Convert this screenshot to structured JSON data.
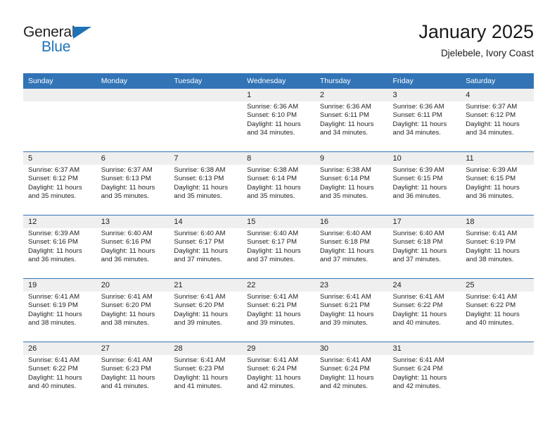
{
  "brand": {
    "name_top": "General",
    "name_bottom": "Blue",
    "triangle_color": "#1d72b8"
  },
  "header": {
    "title": "January 2025",
    "location": "Djelebele, Ivory Coast"
  },
  "theme": {
    "header_blue": "#3274b6",
    "daynum_band": "#efefef",
    "text": "#231f20"
  },
  "calendar": {
    "weekday_headers": [
      "Sunday",
      "Monday",
      "Tuesday",
      "Wednesday",
      "Thursday",
      "Friday",
      "Saturday"
    ],
    "weeks": [
      {
        "days": [
          {
            "num": "",
            "lines": []
          },
          {
            "num": "",
            "lines": []
          },
          {
            "num": "",
            "lines": []
          },
          {
            "num": "1",
            "lines": [
              "Sunrise: 6:36 AM",
              "Sunset: 6:10 PM",
              "Daylight: 11 hours",
              "and 34 minutes."
            ]
          },
          {
            "num": "2",
            "lines": [
              "Sunrise: 6:36 AM",
              "Sunset: 6:11 PM",
              "Daylight: 11 hours",
              "and 34 minutes."
            ]
          },
          {
            "num": "3",
            "lines": [
              "Sunrise: 6:36 AM",
              "Sunset: 6:11 PM",
              "Daylight: 11 hours",
              "and 34 minutes."
            ]
          },
          {
            "num": "4",
            "lines": [
              "Sunrise: 6:37 AM",
              "Sunset: 6:12 PM",
              "Daylight: 11 hours",
              "and 34 minutes."
            ]
          }
        ]
      },
      {
        "days": [
          {
            "num": "5",
            "lines": [
              "Sunrise: 6:37 AM",
              "Sunset: 6:12 PM",
              "Daylight: 11 hours",
              "and 35 minutes."
            ]
          },
          {
            "num": "6",
            "lines": [
              "Sunrise: 6:37 AM",
              "Sunset: 6:13 PM",
              "Daylight: 11 hours",
              "and 35 minutes."
            ]
          },
          {
            "num": "7",
            "lines": [
              "Sunrise: 6:38 AM",
              "Sunset: 6:13 PM",
              "Daylight: 11 hours",
              "and 35 minutes."
            ]
          },
          {
            "num": "8",
            "lines": [
              "Sunrise: 6:38 AM",
              "Sunset: 6:14 PM",
              "Daylight: 11 hours",
              "and 35 minutes."
            ]
          },
          {
            "num": "9",
            "lines": [
              "Sunrise: 6:38 AM",
              "Sunset: 6:14 PM",
              "Daylight: 11 hours",
              "and 35 minutes."
            ]
          },
          {
            "num": "10",
            "lines": [
              "Sunrise: 6:39 AM",
              "Sunset: 6:15 PM",
              "Daylight: 11 hours",
              "and 36 minutes."
            ]
          },
          {
            "num": "11",
            "lines": [
              "Sunrise: 6:39 AM",
              "Sunset: 6:15 PM",
              "Daylight: 11 hours",
              "and 36 minutes."
            ]
          }
        ]
      },
      {
        "days": [
          {
            "num": "12",
            "lines": [
              "Sunrise: 6:39 AM",
              "Sunset: 6:16 PM",
              "Daylight: 11 hours",
              "and 36 minutes."
            ]
          },
          {
            "num": "13",
            "lines": [
              "Sunrise: 6:40 AM",
              "Sunset: 6:16 PM",
              "Daylight: 11 hours",
              "and 36 minutes."
            ]
          },
          {
            "num": "14",
            "lines": [
              "Sunrise: 6:40 AM",
              "Sunset: 6:17 PM",
              "Daylight: 11 hours",
              "and 37 minutes."
            ]
          },
          {
            "num": "15",
            "lines": [
              "Sunrise: 6:40 AM",
              "Sunset: 6:17 PM",
              "Daylight: 11 hours",
              "and 37 minutes."
            ]
          },
          {
            "num": "16",
            "lines": [
              "Sunrise: 6:40 AM",
              "Sunset: 6:18 PM",
              "Daylight: 11 hours",
              "and 37 minutes."
            ]
          },
          {
            "num": "17",
            "lines": [
              "Sunrise: 6:40 AM",
              "Sunset: 6:18 PM",
              "Daylight: 11 hours",
              "and 37 minutes."
            ]
          },
          {
            "num": "18",
            "lines": [
              "Sunrise: 6:41 AM",
              "Sunset: 6:19 PM",
              "Daylight: 11 hours",
              "and 38 minutes."
            ]
          }
        ]
      },
      {
        "days": [
          {
            "num": "19",
            "lines": [
              "Sunrise: 6:41 AM",
              "Sunset: 6:19 PM",
              "Daylight: 11 hours",
              "and 38 minutes."
            ]
          },
          {
            "num": "20",
            "lines": [
              "Sunrise: 6:41 AM",
              "Sunset: 6:20 PM",
              "Daylight: 11 hours",
              "and 38 minutes."
            ]
          },
          {
            "num": "21",
            "lines": [
              "Sunrise: 6:41 AM",
              "Sunset: 6:20 PM",
              "Daylight: 11 hours",
              "and 39 minutes."
            ]
          },
          {
            "num": "22",
            "lines": [
              "Sunrise: 6:41 AM",
              "Sunset: 6:21 PM",
              "Daylight: 11 hours",
              "and 39 minutes."
            ]
          },
          {
            "num": "23",
            "lines": [
              "Sunrise: 6:41 AM",
              "Sunset: 6:21 PM",
              "Daylight: 11 hours",
              "and 39 minutes."
            ]
          },
          {
            "num": "24",
            "lines": [
              "Sunrise: 6:41 AM",
              "Sunset: 6:22 PM",
              "Daylight: 11 hours",
              "and 40 minutes."
            ]
          },
          {
            "num": "25",
            "lines": [
              "Sunrise: 6:41 AM",
              "Sunset: 6:22 PM",
              "Daylight: 11 hours",
              "and 40 minutes."
            ]
          }
        ]
      },
      {
        "days": [
          {
            "num": "26",
            "lines": [
              "Sunrise: 6:41 AM",
              "Sunset: 6:22 PM",
              "Daylight: 11 hours",
              "and 40 minutes."
            ]
          },
          {
            "num": "27",
            "lines": [
              "Sunrise: 6:41 AM",
              "Sunset: 6:23 PM",
              "Daylight: 11 hours",
              "and 41 minutes."
            ]
          },
          {
            "num": "28",
            "lines": [
              "Sunrise: 6:41 AM",
              "Sunset: 6:23 PM",
              "Daylight: 11 hours",
              "and 41 minutes."
            ]
          },
          {
            "num": "29",
            "lines": [
              "Sunrise: 6:41 AM",
              "Sunset: 6:24 PM",
              "Daylight: 11 hours",
              "and 42 minutes."
            ]
          },
          {
            "num": "30",
            "lines": [
              "Sunrise: 6:41 AM",
              "Sunset: 6:24 PM",
              "Daylight: 11 hours",
              "and 42 minutes."
            ]
          },
          {
            "num": "31",
            "lines": [
              "Sunrise: 6:41 AM",
              "Sunset: 6:24 PM",
              "Daylight: 11 hours",
              "and 42 minutes."
            ]
          },
          {
            "num": "",
            "lines": []
          }
        ]
      }
    ]
  }
}
